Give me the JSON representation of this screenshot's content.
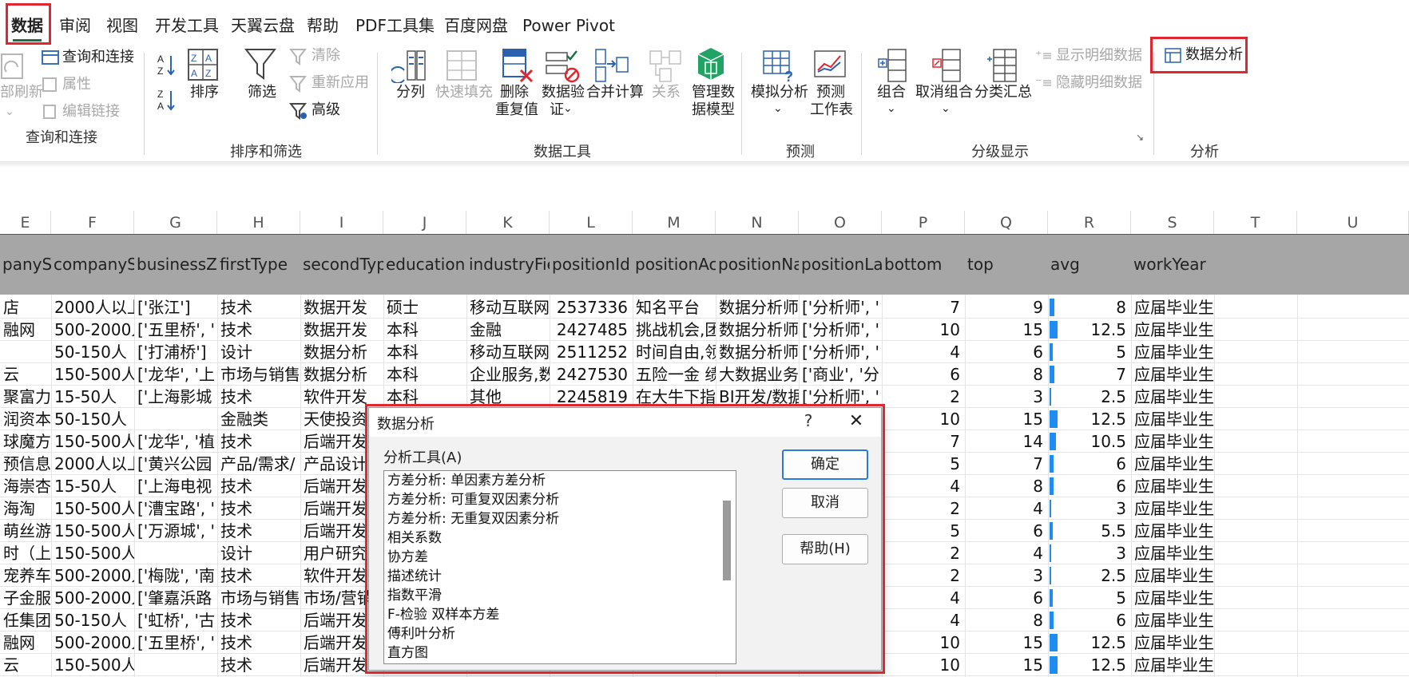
{
  "ribbon_tabs": [
    {
      "label": "数据",
      "active": true
    },
    {
      "label": "审阅"
    },
    {
      "label": "视图"
    },
    {
      "label": "开发工具"
    },
    {
      "label": "天翼云盘"
    },
    {
      "label": "帮助"
    },
    {
      "label": "PDF工具集"
    },
    {
      "label": "百度网盘"
    },
    {
      "label": "Power Pivot"
    }
  ],
  "ribbon": {
    "query_group": {
      "label": "查询和连接",
      "refresh_all": "部刷新",
      "query_connections": "查询和连接",
      "properties": "属性",
      "edit_links": "编辑链接"
    },
    "sort_filter_group": {
      "label": "排序和筛选",
      "sort": "排序",
      "filter": "筛选",
      "clear": "清除",
      "reapply": "重新应用",
      "advanced": "高级"
    },
    "data_tools_group": {
      "label": "数据工具",
      "text_to_columns": "分列",
      "flash_fill": "快速填充",
      "remove_duplicates_1": "删除",
      "remove_duplicates_2": "重复值",
      "data_validation_1": "数据验",
      "data_validation_2": "证",
      "consolidate": "合并计算",
      "relationships": "关系",
      "data_model_1": "管理数",
      "data_model_2": "据模型"
    },
    "forecast_group": {
      "label": "预测",
      "what_if": "模拟分析",
      "forecast_sheet_1": "预测",
      "forecast_sheet_2": "工作表"
    },
    "outline_group": {
      "label": "分级显示",
      "group": "组合",
      "ungroup": "取消组合",
      "subtotal": "分类汇总",
      "show_detail": "显示明细数据",
      "hide_detail": "隐藏明细数据"
    },
    "analysis_group": {
      "label": "分析",
      "data_analysis": "数据分析"
    }
  },
  "columns": [
    "E",
    "F",
    "G",
    "H",
    "I",
    "J",
    "K",
    "L",
    "M",
    "N",
    "O",
    "P",
    "Q",
    "R",
    "S",
    "T",
    "U"
  ],
  "headers": [
    "panyS",
    "companyS",
    "businessZo",
    "firstType",
    "secondTyp",
    "education",
    "industryFie",
    "positionId",
    "positionAc",
    "positionNa",
    "positionLa",
    "bottom",
    "top",
    "avg",
    "workYear",
    "",
    ""
  ],
  "rows": [
    [
      "店",
      "2000人以上",
      "['张江']",
      "技术",
      "数据开发",
      "硕士",
      "移动互联网",
      "2537336",
      "知名平台",
      "数据分析师",
      "['分析师', '",
      "7",
      "9",
      "8",
      "应届毕业生"
    ],
    [
      "融网",
      "500-2000人",
      "['五里桥', '",
      "技术",
      "数据开发",
      "本科",
      "金融",
      "2427485",
      "挑战机会,团",
      "数据分析师",
      "['分析师', '",
      "10",
      "15",
      "12.5",
      "应届毕业生"
    ],
    [
      "",
      "50-150人",
      "['打浦桥']",
      "设计",
      "数据分析",
      "本科",
      "移动互联网",
      "2511252",
      "时间自由,领",
      "数据分析师",
      "['分析师', '",
      "4",
      "6",
      "5",
      "应届毕业生"
    ],
    [
      "云",
      "150-500人",
      "['龙华', '上",
      "市场与销售",
      "数据分析",
      "本科",
      "企业服务,数",
      "2427530",
      "五险一金 绩",
      "大数据业务",
      "['商业', '分",
      "6",
      "8",
      "7",
      "应届毕业生"
    ],
    [
      "聚富力",
      "15-50人",
      "['上海影城",
      "技术",
      "软件开发",
      "本科",
      "其他",
      "2245819",
      "在大牛下指",
      "BI开发/数据",
      "['分析师', '",
      "2",
      "3",
      "2.5",
      "应届毕业生"
    ],
    [
      "润资本",
      "50-150人",
      "",
      "金融类",
      "天使投资",
      "",
      "",
      "",
      "",
      "",
      "",
      "10",
      "15",
      "12.5",
      "应届毕业生"
    ],
    [
      "球魔方",
      "150-500人",
      "['龙华', '植",
      "技术",
      "后端开发",
      "",
      "",
      "",
      "",
      "",
      "",
      "7",
      "14",
      "10.5",
      "应届毕业生"
    ],
    [
      "预信息",
      "2000人以上",
      "['黄兴公园",
      "产品/需求/",
      "产品设计",
      "",
      "",
      "",
      "",
      "",
      "",
      "5",
      "7",
      "6",
      "应届毕业生"
    ],
    [
      "海崇杏",
      "15-50人",
      "['上海电视",
      "技术",
      "后端开发",
      "",
      "",
      "",
      "",
      "",
      "",
      "4",
      "8",
      "6",
      "应届毕业生"
    ],
    [
      "海淘",
      "150-500人",
      "['漕宝路', '",
      "技术",
      "后端开发",
      "",
      "",
      "",
      "",
      "",
      "",
      "2",
      "4",
      "3",
      "应届毕业生"
    ],
    [
      "萌丝游戏",
      "150-500人",
      "['万源城', '",
      "技术",
      "后端开发",
      "",
      "",
      "",
      "",
      "",
      "",
      "5",
      "6",
      "5.5",
      "应届毕业生"
    ],
    [
      "时（上海",
      "150-500人",
      "",
      "设计",
      "用户研究",
      "",
      "",
      "",
      "",
      "",
      "",
      "2",
      "4",
      "3",
      "应届毕业生"
    ],
    [
      "宠养车网",
      "500-2000人",
      "['梅陇', '南",
      "技术",
      "软件开发",
      "",
      "",
      "",
      "",
      "",
      "",
      "2",
      "3",
      "2.5",
      "应届毕业生"
    ],
    [
      "子金服",
      "500-2000人",
      "['肇嘉浜路",
      "市场与销售",
      "市场/营销",
      "",
      "",
      "",
      "",
      "",
      "",
      "4",
      "6",
      "5",
      "应届毕业生"
    ],
    [
      "任集团火",
      "50-150人",
      "['虹桥', '古",
      "技术",
      "后端开发",
      "",
      "",
      "",
      "",
      "",
      "",
      "4",
      "8",
      "6",
      "应届毕业生"
    ],
    [
      "融网",
      "500-2000人",
      "['五里桥', '",
      "技术",
      "后端开发",
      "",
      "",
      "",
      "",
      "",
      "",
      "10",
      "15",
      "12.5",
      "应届毕业生"
    ],
    [
      "云",
      "150-500人",
      "",
      "技术",
      "后端开发",
      "",
      "",
      "",
      "",
      "",
      "",
      "10",
      "15",
      "12.5",
      "应届毕业生"
    ]
  ],
  "avg_max": 12.5,
  "dialog": {
    "title": "数据分析",
    "help_glyph": "?",
    "close_glyph": "✕",
    "list_label": "分析工具(A)",
    "tools": [
      "方差分析: 单因素方差分析",
      "方差分析: 可重复双因素分析",
      "方差分析: 无重复双因素分析",
      "相关系数",
      "协方差",
      "描述统计",
      "指数平滑",
      "F-检验 双样本方差",
      "傅利叶分析",
      "直方图"
    ],
    "ok": "确定",
    "cancel": "取消",
    "help": "帮助(H)"
  },
  "colors": {
    "accent": "#1e7145",
    "highlight": "#e0262f",
    "databar": "#1e8cf0",
    "header_fill": "#a6a6a6"
  }
}
